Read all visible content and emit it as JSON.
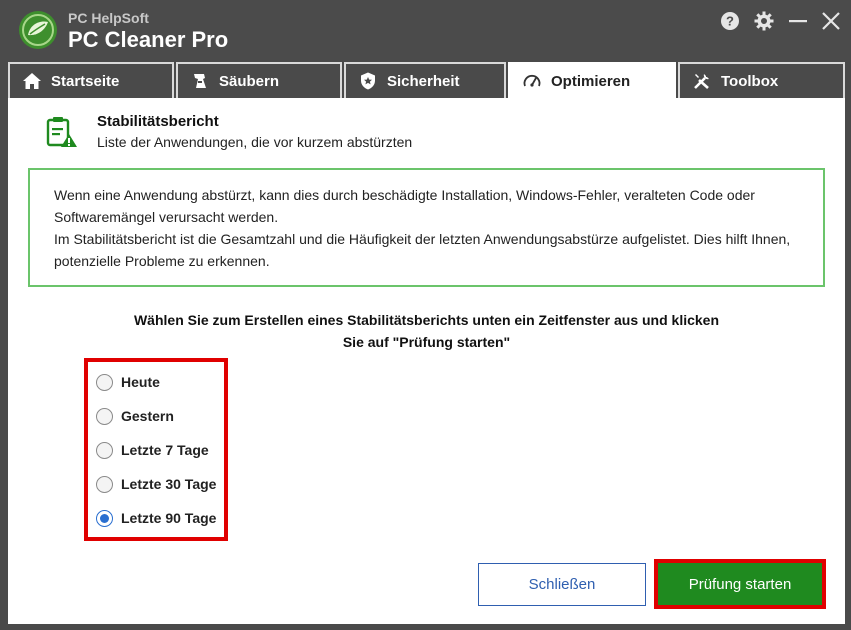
{
  "app": {
    "brand_small": "PC HelpSoft",
    "brand_title": "PC Cleaner Pro"
  },
  "window_controls": [
    "help-icon",
    "gear-icon",
    "minimize-icon",
    "close-icon"
  ],
  "tabs": [
    {
      "label": "Startseite",
      "icon": "home-icon"
    },
    {
      "label": "Säubern",
      "icon": "broom-icon"
    },
    {
      "label": "Sicherheit",
      "icon": "shield-icon"
    },
    {
      "label": "Optimieren",
      "icon": "speedometer-icon"
    },
    {
      "label": "Toolbox",
      "icon": "tools-icon"
    }
  ],
  "active_tab": "Optimieren",
  "header": {
    "title": "Stabilitätsbericht",
    "subtitle": "Liste der Anwendungen, die vor kurzem abstürzten"
  },
  "info": {
    "line1": "Wenn eine Anwendung abstürzt, kann dies durch beschädigte Installation, Windows-Fehler, veralteten Code oder",
    "line2": "Softwaremängel verursacht werden.",
    "line3": "Im Stabilitätsbericht ist die Gesamtzahl und die Häufigkeit der letzten Anwendungsabstürze aufgelistet. Dies hilft Ihnen,",
    "line4": "potenzielle Probleme zu erkennen."
  },
  "instruction": {
    "line1": "Wählen Sie zum Erstellen eines Stabilitätsberichts unten ein Zeitfenster aus und klicken",
    "line2": "Sie auf \"Prüfung starten\""
  },
  "options": [
    {
      "label": "Heute",
      "checked": false
    },
    {
      "label": "Gestern",
      "checked": false
    },
    {
      "label": "Letzte 7 Tage",
      "checked": false
    },
    {
      "label": "Letzte 30 Tage",
      "checked": false
    },
    {
      "label": "Letzte 90 Tage",
      "checked": true
    }
  ],
  "buttons": {
    "close": "Schließen",
    "start": "Prüfung starten"
  },
  "colors": {
    "accent_green": "#1f8a1f",
    "highlight_red": "#e00000",
    "link_blue": "#2f5fb0",
    "titlebar": "#4b4b4b"
  }
}
